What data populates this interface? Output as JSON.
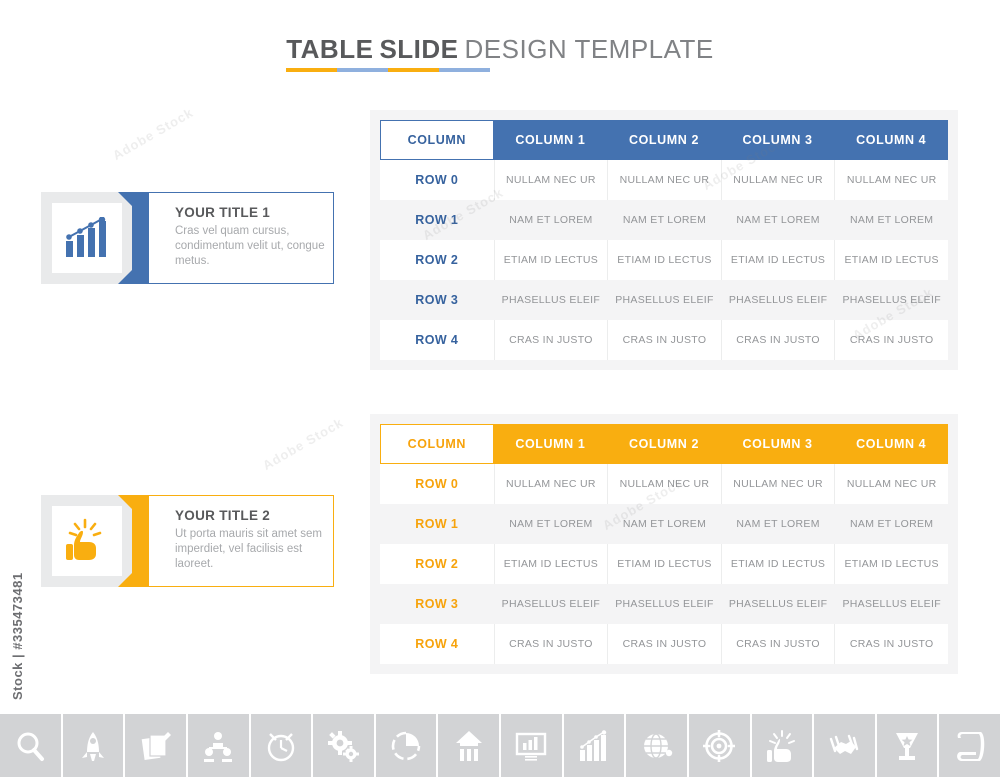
{
  "header": {
    "title_bold_1": "TABLE",
    "title_bold_2": "SLIDE",
    "title_light": "DESIGN TEMPLATE"
  },
  "colors": {
    "blue": "#4472b0",
    "blue_text": "#36629e",
    "orange": "#f9ae10",
    "orange_text": "#f7a30c",
    "panel_bg": "#f4f4f5",
    "icon_tile_bg": "#e9eaeb",
    "body_text": "#a7a9ac",
    "title_text": "#58595b",
    "cell_text": "#939598",
    "iconbar_bg": "#d2d3d5"
  },
  "cards": [
    {
      "title": "YOUR TITLE 1",
      "desc": "Cras vel quam cursus, condimentum velit ut, congue metus.",
      "icon": "bar-chart-growth-icon",
      "accent": "#4472b0"
    },
    {
      "title": "YOUR TITLE 2",
      "desc": "Ut porta mauris sit amet sem imperdiet, vel facilisis est laoreet.",
      "icon": "thumbs-up-icon",
      "accent": "#f9ae10"
    }
  ],
  "tables": [
    {
      "accent": "blue",
      "headers": [
        "COLUMN",
        "COLUMN 1",
        "COLUMN 2",
        "COLUMN 3",
        "COLUMN 4"
      ],
      "rows": [
        {
          "label": "ROW 0",
          "cells": [
            "NULLAM NEC UR",
            "NULLAM NEC UR",
            "NULLAM NEC UR",
            "NULLAM NEC UR"
          ]
        },
        {
          "label": "ROW 1",
          "cells": [
            "NAM ET LOREM",
            "NAM ET LOREM",
            "NAM ET LOREM",
            "NAM ET LOREM"
          ]
        },
        {
          "label": "ROW 2",
          "cells": [
            "ETIAM ID LECTUS",
            "ETIAM ID LECTUS",
            "ETIAM ID LECTUS",
            "ETIAM ID LECTUS"
          ]
        },
        {
          "label": "ROW 3",
          "cells": [
            "PHASELLUS ELEIF",
            "PHASELLUS ELEIF",
            "PHASELLUS ELEIF",
            "PHASELLUS ELEIF"
          ]
        },
        {
          "label": "ROW 4",
          "cells": [
            "CRAS IN JUSTO",
            "CRAS IN JUSTO",
            "CRAS IN JUSTO",
            "CRAS IN JUSTO"
          ]
        }
      ]
    },
    {
      "accent": "orange",
      "headers": [
        "COLUMN",
        "COLUMN 1",
        "COLUMN 2",
        "COLUMN 3",
        "COLUMN 4"
      ],
      "rows": [
        {
          "label": "ROW 0",
          "cells": [
            "NULLAM NEC UR",
            "NULLAM NEC UR",
            "NULLAM NEC UR",
            "NULLAM NEC UR"
          ]
        },
        {
          "label": "ROW 1",
          "cells": [
            "NAM ET LOREM",
            "NAM ET LOREM",
            "NAM ET LOREM",
            "NAM ET LOREM"
          ]
        },
        {
          "label": "ROW 2",
          "cells": [
            "ETIAM ID LECTUS",
            "ETIAM ID LECTUS",
            "ETIAM ID LECTUS",
            "ETIAM ID LECTUS"
          ]
        },
        {
          "label": "ROW 3",
          "cells": [
            "PHASELLUS ELEIF",
            "PHASELLUS ELEIF",
            "PHASELLUS ELEIF",
            "PHASELLUS ELEIF"
          ]
        },
        {
          "label": "ROW 4",
          "cells": [
            "CRAS IN JUSTO",
            "CRAS IN JUSTO",
            "CRAS IN JUSTO",
            "CRAS IN JUSTO"
          ]
        }
      ]
    }
  ],
  "icon_strip": [
    "magnifier-icon",
    "rocket-icon",
    "document-pen-icon",
    "org-chart-icon",
    "clock-icon",
    "gears-icon",
    "pie-chart-icon",
    "up-arrow-icon",
    "presentation-monitor-icon",
    "bar-chart-icon",
    "globe-icon",
    "target-icon",
    "thumbs-up-icon",
    "handshake-icon",
    "trophy-icon",
    "scroll-document-icon"
  ],
  "watermark": {
    "id_text": "Stock | #335473481",
    "repeat_text": "Adobe Stock"
  }
}
